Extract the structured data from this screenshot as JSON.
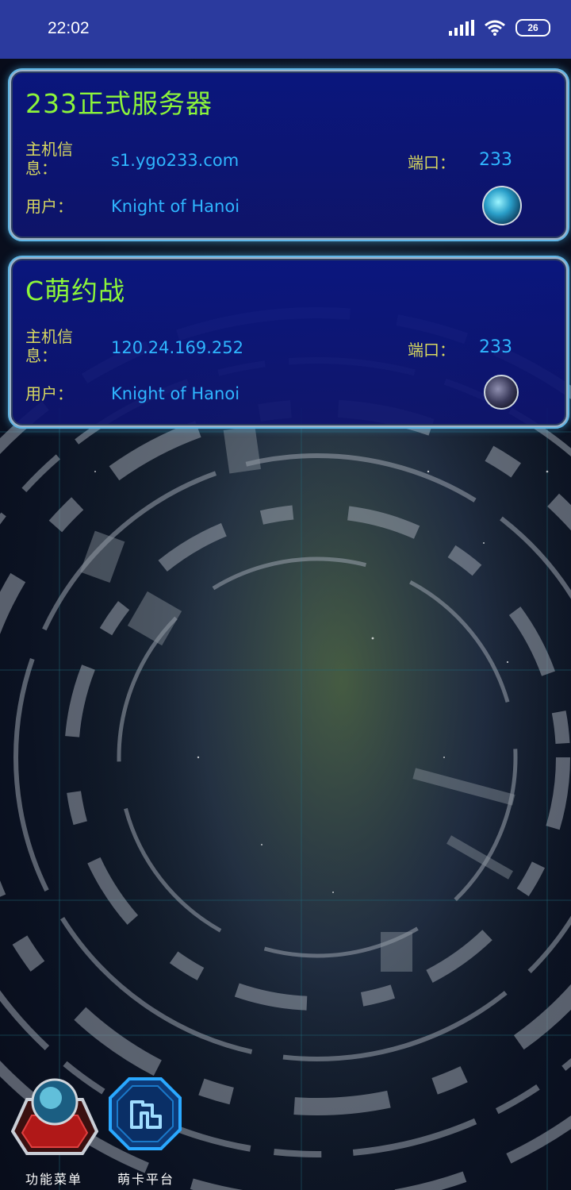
{
  "status_bar": {
    "time": "22:02",
    "battery": "26",
    "icons": [
      "signal-icon",
      "wifi-icon",
      "battery-icon"
    ]
  },
  "servers": [
    {
      "name": "233正式服务器",
      "host_label": "主机信息：",
      "host": "s1.ygo233.com",
      "port_label": "端口：",
      "port": "233",
      "user_label": "用户：",
      "user": "Knight of Hanoi",
      "avatar_icon": "server-avatar-icon"
    },
    {
      "name": "C萌约战",
      "host_label": "主机信息：",
      "host": "120.24.169.252",
      "port_label": "端口：",
      "port": "233",
      "user_label": "用户：",
      "user": "Knight of Hanoi",
      "avatar_icon": "server-avatar-icon"
    }
  ],
  "bottom_nav": {
    "menu_label": "功能菜单",
    "platform_label": "萌卡平台"
  },
  "colors": {
    "status_bar": "#2b3a9e",
    "title": "#8cf53a",
    "label": "#d8d860",
    "value": "#2fb6ff"
  }
}
